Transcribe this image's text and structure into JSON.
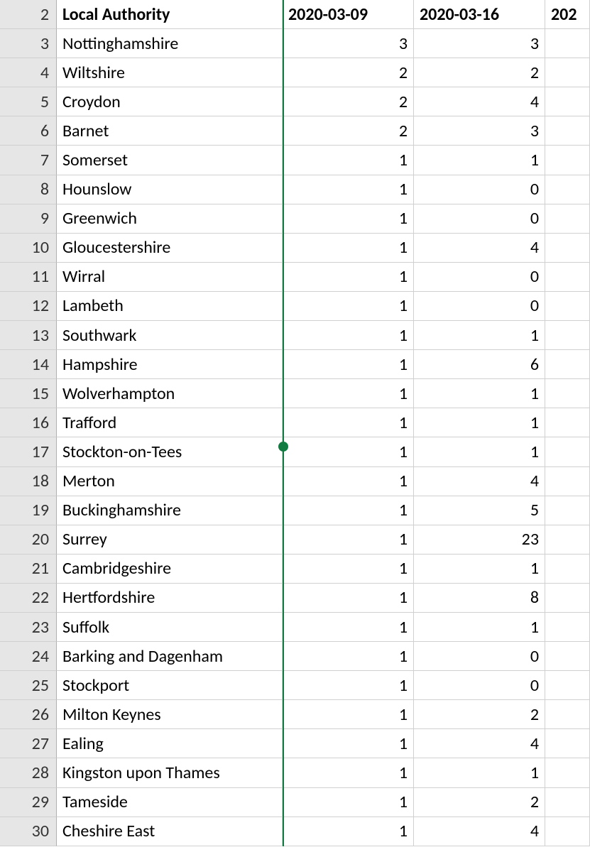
{
  "headers": {
    "col_a": "Local Authority",
    "col_b": "2020-03-09",
    "col_c": "2020-03-16",
    "col_d": "202"
  },
  "rows": [
    {
      "n": "2",
      "a": "Local Authority",
      "b": "2020-03-09",
      "c": "2020-03-16",
      "d": "202",
      "header": true
    },
    {
      "n": "3",
      "a": "Nottinghamshire",
      "b": "3",
      "c": "3",
      "d": ""
    },
    {
      "n": "4",
      "a": "Wiltshire",
      "b": "2",
      "c": "2",
      "d": ""
    },
    {
      "n": "5",
      "a": "Croydon",
      "b": "2",
      "c": "4",
      "d": ""
    },
    {
      "n": "6",
      "a": "Barnet",
      "b": "2",
      "c": "3",
      "d": ""
    },
    {
      "n": "7",
      "a": "Somerset",
      "b": "1",
      "c": "1",
      "d": ""
    },
    {
      "n": "8",
      "a": "Hounslow",
      "b": "1",
      "c": "0",
      "d": ""
    },
    {
      "n": "9",
      "a": "Greenwich",
      "b": "1",
      "c": "0",
      "d": ""
    },
    {
      "n": "10",
      "a": "Gloucestershire",
      "b": "1",
      "c": "4",
      "d": ""
    },
    {
      "n": "11",
      "a": "Wirral",
      "b": "1",
      "c": "0",
      "d": ""
    },
    {
      "n": "12",
      "a": "Lambeth",
      "b": "1",
      "c": "0",
      "d": ""
    },
    {
      "n": "13",
      "a": "Southwark",
      "b": "1",
      "c": "1",
      "d": ""
    },
    {
      "n": "14",
      "a": "Hampshire",
      "b": "1",
      "c": "6",
      "d": ""
    },
    {
      "n": "15",
      "a": "Wolverhampton",
      "b": "1",
      "c": "1",
      "d": ""
    },
    {
      "n": "16",
      "a": "Trafford",
      "b": "1",
      "c": "1",
      "d": ""
    },
    {
      "n": "17",
      "a": "Stockton-on-Tees",
      "b": "1",
      "c": "1",
      "d": ""
    },
    {
      "n": "18",
      "a": "Merton",
      "b": "1",
      "c": "4",
      "d": ""
    },
    {
      "n": "19",
      "a": "Buckinghamshire",
      "b": "1",
      "c": "5",
      "d": ""
    },
    {
      "n": "20",
      "a": "Surrey",
      "b": "1",
      "c": "23",
      "d": ""
    },
    {
      "n": "21",
      "a": "Cambridgeshire",
      "b": "1",
      "c": "1",
      "d": ""
    },
    {
      "n": "22",
      "a": "Hertfordshire",
      "b": "1",
      "c": "8",
      "d": ""
    },
    {
      "n": "23",
      "a": "Suffolk",
      "b": "1",
      "c": "1",
      "d": ""
    },
    {
      "n": "24",
      "a": "Barking and Dagenham",
      "b": "1",
      "c": "0",
      "d": ""
    },
    {
      "n": "25",
      "a": "Stockport",
      "b": "1",
      "c": "0",
      "d": ""
    },
    {
      "n": "26",
      "a": "Milton Keynes",
      "b": "1",
      "c": "2",
      "d": ""
    },
    {
      "n": "27",
      "a": "Ealing",
      "b": "1",
      "c": "4",
      "d": ""
    },
    {
      "n": "28",
      "a": "Kingston upon Thames",
      "b": "1",
      "c": "1",
      "d": ""
    },
    {
      "n": "29",
      "a": "Tameside",
      "b": "1",
      "c": "2",
      "d": ""
    },
    {
      "n": "30",
      "a": "Cheshire East",
      "b": "1",
      "c": "4",
      "d": ""
    }
  ]
}
